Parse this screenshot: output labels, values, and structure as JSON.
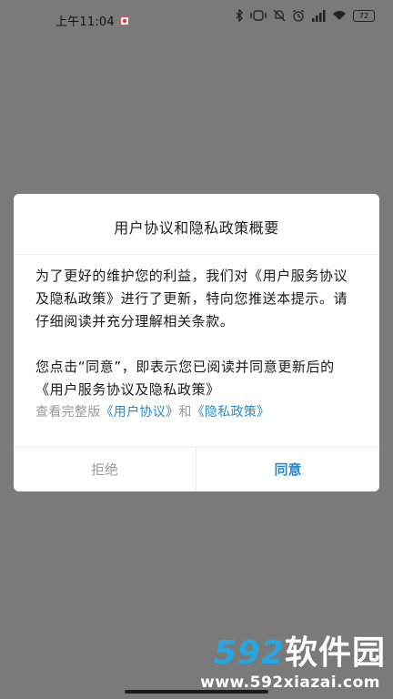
{
  "status_bar": {
    "time": "上午11:04",
    "battery": "72"
  },
  "dialog": {
    "title": "用户协议和隐私政策概要",
    "paragraph1": "为了更好的维护您的利益，我们对《用户服务协议及隐私政策》进行了更新，特向您推送本提示。请仔细阅读并充分理解相关条款。",
    "paragraph2": "您点击“同意”，即表示您已阅读并同意更新后的 《用户服务协议及隐私政策》",
    "view_prefix": "查看完整版",
    "user_agreement_link": "《用户协议》",
    "and_text": "和",
    "privacy_policy_link": "《隐私政策》",
    "reject_label": "拒绝",
    "agree_label": "同意"
  },
  "watermark": {
    "number": "592",
    "name": "软件园",
    "url": "www.592xiazai.com"
  },
  "colors": {
    "overlay": "#7a7a7a",
    "link": "#2d8ac6",
    "muted": "#9a9a9a"
  }
}
